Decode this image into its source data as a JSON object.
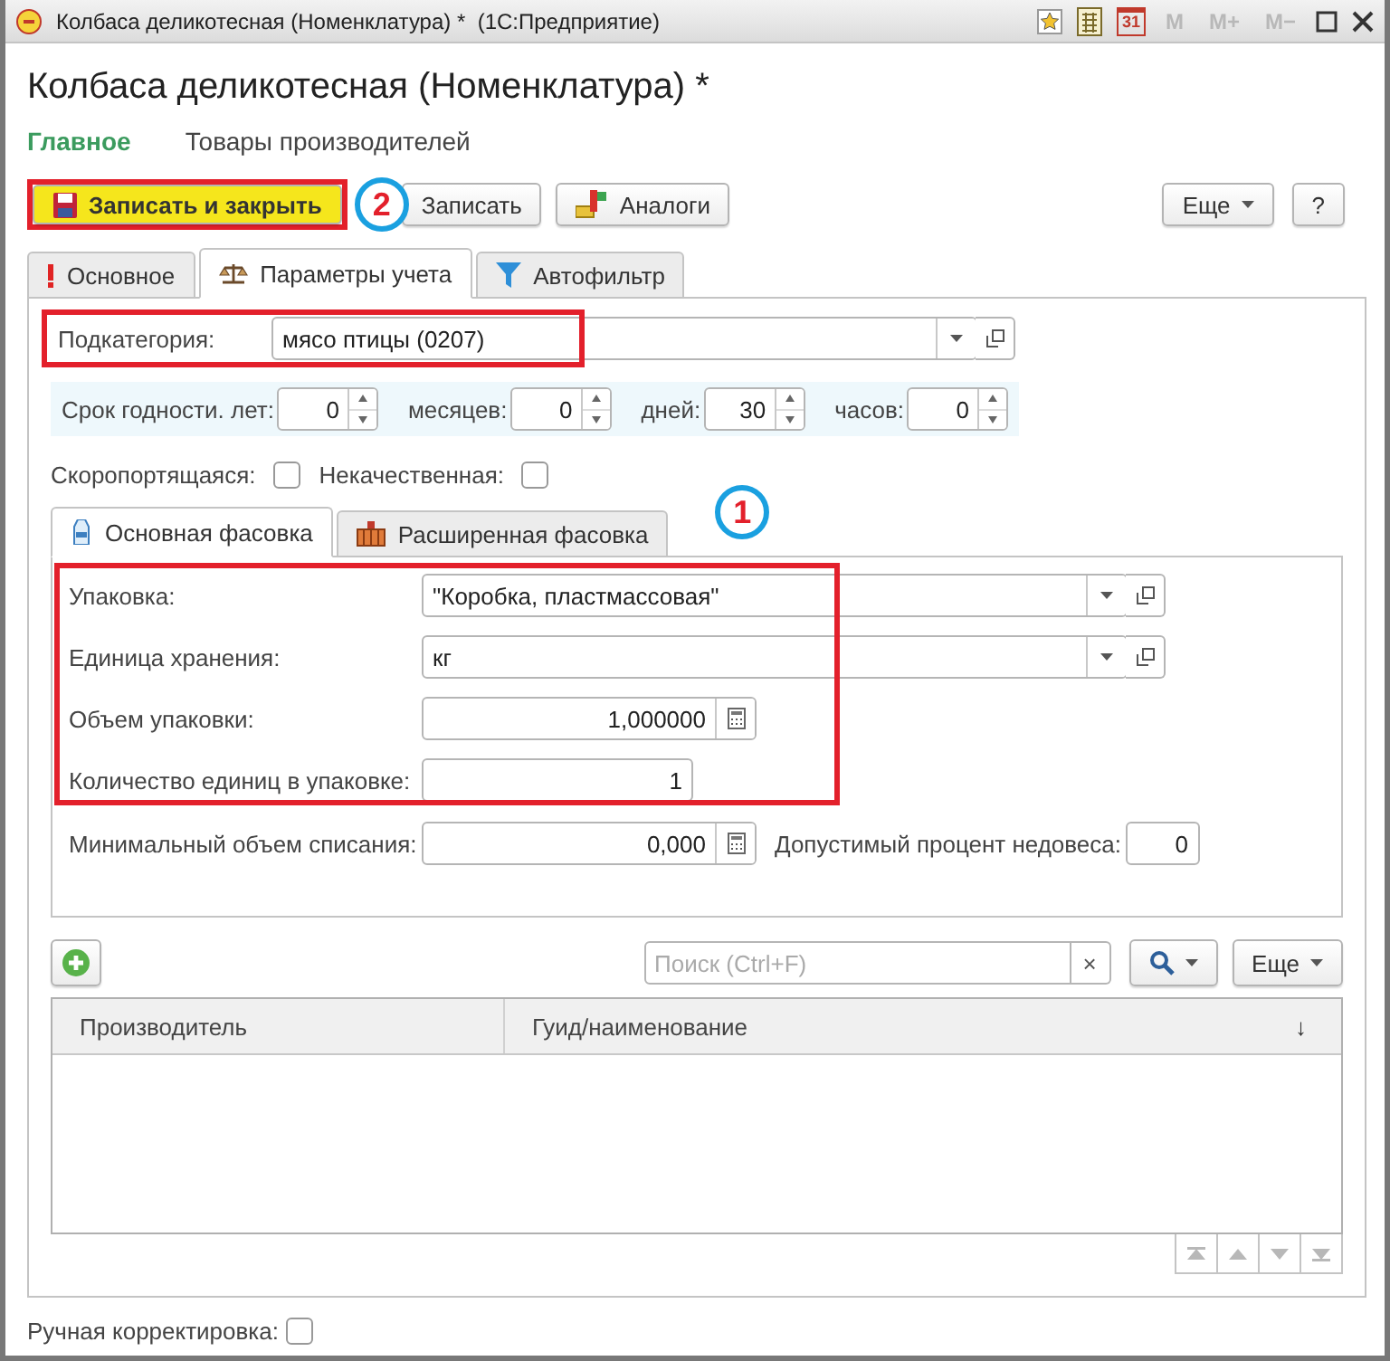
{
  "window": {
    "title": "Колбаса деликотесная (Номенклатура) *  (1С:Предприятие)",
    "calendar_day": "31",
    "memory_buttons": [
      {
        "label": "M",
        "disabled": true
      },
      {
        "label": "M+",
        "disabled": true
      },
      {
        "label": "M−",
        "disabled": true
      }
    ]
  },
  "heading": "Колбаса деликотесная (Номенклатура) *",
  "nav": [
    {
      "label": "Главное",
      "selected": true
    },
    {
      "label": "Товары производителей",
      "selected": false
    }
  ],
  "toolbar": {
    "buttons": [
      {
        "label": "Записать и закрыть",
        "kind": "primary",
        "highlighted": true
      },
      {
        "label": "Записать",
        "kind": "plain",
        "highlighted": false
      },
      {
        "label": "Аналоги",
        "kind": "analogs",
        "highlighted": false
      }
    ],
    "marker": "2",
    "more": "Еще",
    "help": "?"
  },
  "tabs": [
    {
      "label": "Основное",
      "selected": false
    },
    {
      "label": "Параметры учета",
      "selected": true
    },
    {
      "label": "Автофильтр",
      "selected": false
    }
  ],
  "subcategory": {
    "label": "Подкатегория:",
    "value": "мясо птицы (0207)",
    "highlighted": true
  },
  "shelf_life": [
    {
      "label": "Срок годности. лет:",
      "value": "0"
    },
    {
      "label": "месяцев:",
      "value": "0"
    },
    {
      "label": "дней:",
      "value": "30"
    },
    {
      "label": "часов:",
      "value": "0"
    }
  ],
  "flags": [
    {
      "label": "Скоропортящаяся:",
      "checked": false
    },
    {
      "label": "Некачественная:",
      "checked": false
    }
  ],
  "inner_tabs": [
    {
      "label": "Основная фасовка",
      "selected": true
    },
    {
      "label": "Расширенная фасовка",
      "selected": false
    }
  ],
  "inner_marker": "1",
  "packaging": {
    "highlighted": true,
    "fields": [
      {
        "label": "Упаковка:",
        "value": "\"Коробка, пластмассовая\"",
        "kind": "select"
      },
      {
        "label": "Единица хранения:",
        "value": "кг",
        "kind": "select"
      },
      {
        "label": "Объем упаковки:",
        "value": "1,000000",
        "kind": "calc"
      },
      {
        "label": "Количество единиц в упаковке:",
        "value": "1",
        "kind": "number"
      }
    ]
  },
  "writeoff": {
    "label": "Минимальный объем списания:",
    "value": "0,000",
    "kind": "calc"
  },
  "underweight": {
    "label": "Допустимый процент недовеса:",
    "value": "0",
    "kind": "number"
  },
  "table": {
    "search": {
      "placeholder": "Поиск (Ctrl+F)",
      "clear": "×"
    },
    "more": "Еще",
    "columns": [
      "Производитель",
      "Гуид/наименование"
    ],
    "sort_mark": "↓"
  },
  "manual": {
    "label": "Ручная корректировка:",
    "checked": false
  }
}
